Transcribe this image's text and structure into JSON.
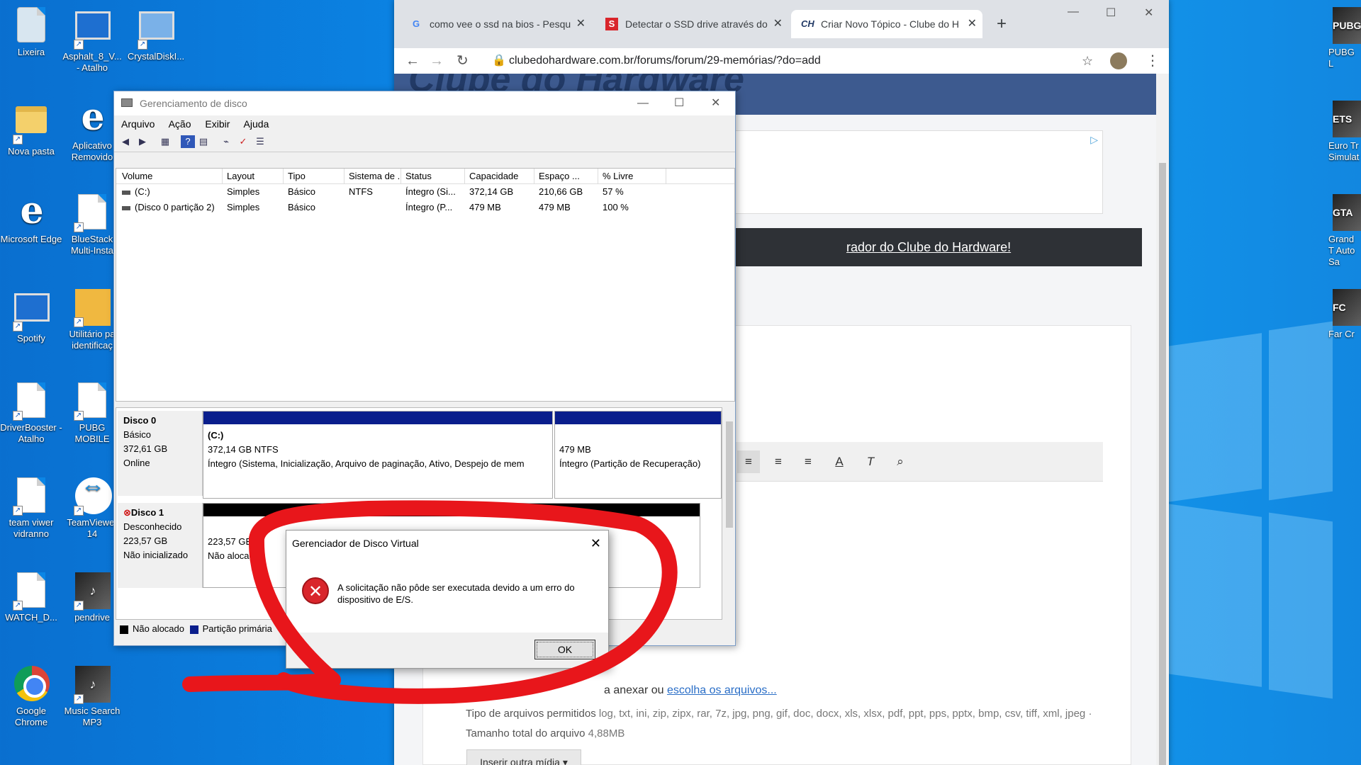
{
  "desktop": {
    "left_icons": [
      {
        "label": "Lixeira"
      },
      {
        "label": "Asphalt_8_V... - Atalho"
      },
      {
        "label": "CrystalDiskI..."
      },
      {
        "label": "Nova pasta"
      },
      {
        "label": "Aplicativo Removido"
      },
      {
        "label": "Microsoft Edge"
      },
      {
        "label": "BlueStack Multi-Insta"
      },
      {
        "label": "Spotify"
      },
      {
        "label": "Utilitário pa identificaç"
      },
      {
        "label": "DriverBooster - Atalho"
      },
      {
        "label": "PUBG MOBILE"
      },
      {
        "label": "team viwer vidranno"
      },
      {
        "label": "TeamViewer 14"
      },
      {
        "label": "WATCH_D..."
      },
      {
        "label": "pendrive"
      },
      {
        "label": "Google Chrome"
      },
      {
        "label": "Music Search MP3"
      }
    ],
    "right_icons": [
      {
        "label": "PUBG L",
        "art": "PUBG"
      },
      {
        "label": "Euro Tr Simulat",
        "art": "ETS"
      },
      {
        "label": "Grand T Auto Sa",
        "art": "GTA"
      },
      {
        "label": "Far Cr",
        "art": "FC"
      }
    ]
  },
  "browser": {
    "tabs": [
      {
        "label": "como vee o ssd na bios - Pesqu",
        "icon": "G"
      },
      {
        "label": "Detectar o SSD drive através do",
        "icon": "S"
      },
      {
        "label": "Criar Novo Tópico - Clube do H",
        "icon": "CH",
        "active": true
      }
    ],
    "url": "clubedohardware.com.br/forums/forum/29-memórias/?do=add",
    "banner_text": "rador do Clube do Hardware!",
    "attach_prefix": "a anexar ou",
    "attach_link": "escolha os arquivos...",
    "types_label": "Tipo de arquivos permitidos",
    "types_list": "log, txt, ini, zip, zipx, rar, 7z, jpg, png, gif, doc, docx, xls, xlsx, pdf, ppt, pps, pptx, bmp, csv, tiff, xml, jpeg",
    "total_label": "Tamanho total do arquivo",
    "total_value": "4,88MB",
    "media_button": "Inserir outra mídia ▾",
    "header_logo": "Clube do Hardware"
  },
  "disk_manager": {
    "title": "Gerenciamento de disco",
    "menu": [
      "Arquivo",
      "Ação",
      "Exibir",
      "Ajuda"
    ],
    "columns": [
      "Volume",
      "Layout",
      "Tipo",
      "Sistema de ...",
      "Status",
      "Capacidade",
      "Espaço ...",
      "% Livre"
    ],
    "rows": [
      [
        "(C:)",
        "Simples",
        "Básico",
        "NTFS",
        "Íntegro (Si...",
        "372,14 GB",
        "210,66 GB",
        "57 %"
      ],
      [
        "(Disco 0 partição 2)",
        "Simples",
        "Básico",
        "",
        "Íntegro (P...",
        "479 MB",
        "479 MB",
        "100 %"
      ]
    ],
    "disk0": {
      "name": "Disco 0",
      "type": "Básico",
      "size": "372,61 GB",
      "state": "Online",
      "part1_name": "(C:)",
      "part1_size": "372,14 GB NTFS",
      "part1_status": "Íntegro (Sistema, Inicialização, Arquivo de paginação, Ativo, Despejo de mem",
      "part2_size": "479 MB",
      "part2_status": "Íntegro (Partição de Recuperação)"
    },
    "disk1": {
      "name": "Disco 1",
      "type": "Desconhecido",
      "size": "223,57 GB",
      "state": "Não inicializado",
      "part_size": "223,57 GB",
      "part_status": "Não alocado"
    },
    "legend": [
      "Não alocado",
      "Partição primária"
    ],
    "legend_colors": {
      "unallocated": "#000000",
      "primary": "#0a1e8c"
    }
  },
  "error_dialog": {
    "title": "Gerenciador de Disco Virtual",
    "message": "A solicitação não pôde ser executada devido a um erro do dispositivo de E/S.",
    "ok": "OK"
  },
  "colors": {
    "accent_red": "#e8161b",
    "desktop_blue": "#0b86e6"
  }
}
